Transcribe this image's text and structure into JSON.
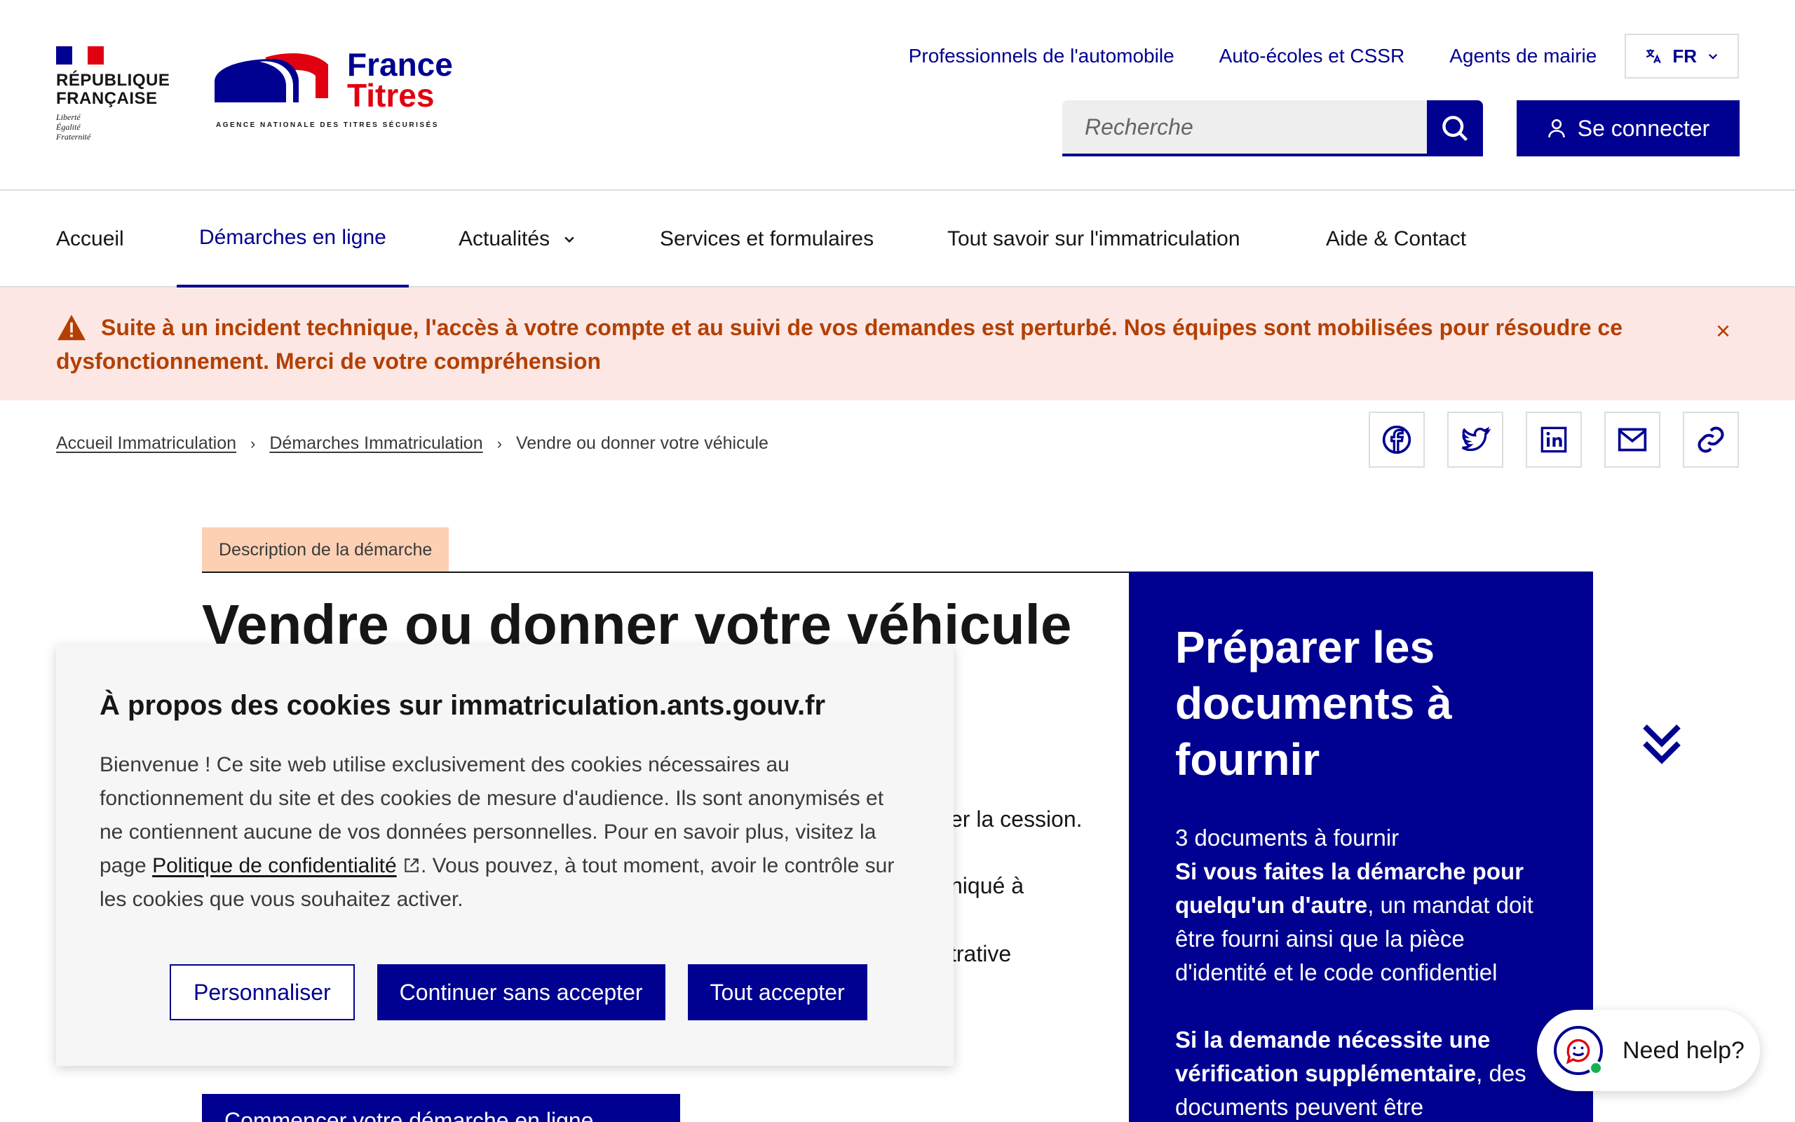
{
  "header": {
    "gov_brand": {
      "line1": "RÉPUBLIQUE",
      "line2": "FRANÇAISE",
      "devise1": "Liberté",
      "devise2": "Égalité",
      "devise3": "Fraternité"
    },
    "site_brand": {
      "name1": "France",
      "name2": "Titres",
      "subtitle": "AGENCE NATIONALE DES TITRES SÉCURISÉS"
    },
    "top_links": [
      "Professionnels de l'automobile",
      "Auto-écoles et CSSR",
      "Agents de mairie"
    ],
    "lang": {
      "label": "FR",
      "icon": "translate-icon"
    },
    "search": {
      "placeholder": "Recherche"
    },
    "login_label": "Se connecter"
  },
  "nav": {
    "items": [
      {
        "label": "Accueil"
      },
      {
        "label": "Démarches en ligne",
        "active": true
      },
      {
        "label": "Actualités",
        "dropdown": true
      },
      {
        "label": "Services et formulaires"
      },
      {
        "label": "Tout savoir sur l'immatriculation"
      },
      {
        "label": "Aide & Contact"
      }
    ]
  },
  "alert": {
    "text": "Suite à un incident technique, l'accès à votre compte et au suivi de vos demandes est perturbé. Nos équipes sont mobilisées pour résoudre ce dysfonctionnement. Merci de votre compréhension",
    "close": "×"
  },
  "breadcrumb": {
    "items": [
      "Accueil Immatriculation",
      "Démarches Immatriculation"
    ],
    "current": "Vendre ou donner votre véhicule"
  },
  "share": [
    "facebook-icon",
    "twitter-icon",
    "linkedin-icon",
    "mail-icon",
    "link-icon"
  ],
  "main": {
    "tag": "Description de la démarche",
    "title": "Vendre ou donner votre véhicule",
    "fragments": [
      "er la cession.",
      "niqué à",
      "trative"
    ],
    "cta": "Commencer votre démarche en ligne"
  },
  "panel": {
    "title": "Préparer les documents à fournir",
    "count": "3 documents à fournir",
    "p1_bold": "Si vous faites la démarche pour quelqu'un d'autre",
    "p1_rest": ", un mandat doit être fourni ainsi que la pièce d'identité et le code confidentiel",
    "p2_bold": "Si la demande nécessite une vérification supplémentaire",
    "p2_rest": ", des documents peuvent être"
  },
  "cookie": {
    "title": "À propos des cookies sur immatriculation.ants.gouv.fr",
    "text_before": "Bienvenue ! Ce site web utilise exclusivement des cookies nécessaires au fonctionnement du site et des cookies de mesure d'audience. Ils sont anonymisés et ne contiennent aucune de vos données personnelles. Pour en savoir plus, visitez la page ",
    "link": "Politique de confidentialité",
    "text_after": ". Vous pouvez, à tout moment, avoir le contrôle sur les cookies que vous souhaitez activer.",
    "buttons": {
      "customize": "Personnaliser",
      "reject": "Continuer sans accepter",
      "accept": "Tout accepter"
    }
  },
  "help": {
    "label": "Need help?"
  },
  "colors": {
    "primary": "#000091",
    "red": "#e1000f",
    "alert_bg": "#fde7e4",
    "alert_text": "#b34000",
    "tag_bg": "#fdd0b4"
  }
}
